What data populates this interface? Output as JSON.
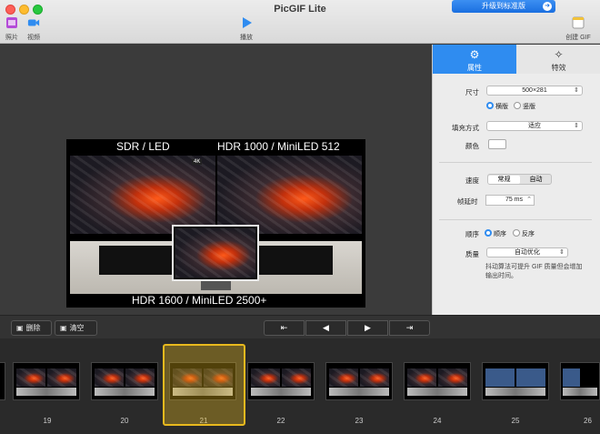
{
  "window": {
    "title": "PicGIF Lite",
    "upgrade_label": "升级到标准版"
  },
  "toolbar": {
    "photo_label": "照片",
    "video_label": "视频",
    "play_label": "播放",
    "create_label": "创建 GIF"
  },
  "preview": {
    "label_top_left": "SDR / LED",
    "label_top_right": "HDR 1000 / MiniLED 512",
    "label_bottom": "HDR 1600 / MiniLED 2500+",
    "badge": "4K"
  },
  "side_tabs": {
    "properties": "属性",
    "effects": "特效"
  },
  "properties": {
    "size_label": "尺寸",
    "size_value": "500×281",
    "orientation": {
      "landscape": "横版",
      "portrait": "竖版",
      "selected": "landscape"
    },
    "fill_label": "填充方式",
    "fill_value": "适应",
    "color_label": "颜色",
    "color_value": "#ffffff",
    "speed_label": "速度",
    "speed_options": [
      "常规",
      "自动"
    ],
    "speed_selected": "常规",
    "delay_label": "帧延时",
    "delay_value": "75 ms",
    "order_label": "顺序",
    "order_options": {
      "forward": "顺序",
      "reverse": "反序",
      "selected": "forward"
    },
    "quality_label": "质量",
    "quality_value": "自动优化",
    "quality_hint": "抖动算法可提升 GIF 质量但会增加输出时间。"
  },
  "controls": {
    "delete_label": "删除",
    "clear_label": "清空"
  },
  "filmstrip": {
    "frames": [
      {
        "number": "19"
      },
      {
        "number": "20"
      },
      {
        "number": "21"
      },
      {
        "number": "22"
      },
      {
        "number": "23"
      },
      {
        "number": "24"
      },
      {
        "number": "25"
      },
      {
        "number": "26"
      }
    ],
    "selected": "21"
  },
  "colors": {
    "accent": "#2f8cf0",
    "selection": "#e8b91e"
  }
}
